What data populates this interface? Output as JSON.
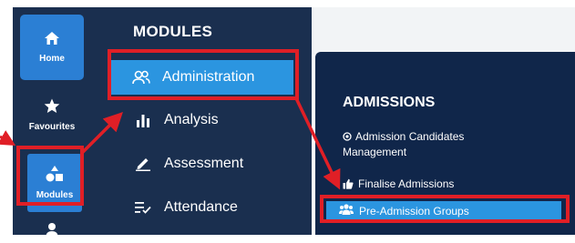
{
  "rail": {
    "home_label": "Home",
    "favourites_label": "Favourites",
    "modules_label": "Modules"
  },
  "modules_panel": {
    "title": "MODULES",
    "items": [
      {
        "label": "Administration",
        "icon": "users-icon"
      },
      {
        "label": "Analysis",
        "icon": "bar-chart-icon"
      },
      {
        "label": "Assessment",
        "icon": "pencil-icon"
      },
      {
        "label": "Attendance",
        "icon": "checklist-icon"
      }
    ]
  },
  "admissions_panel": {
    "title": "ADMISSIONS",
    "links": [
      {
        "label": "Admission Candidates Management",
        "icon": "target-icon"
      },
      {
        "label": "Finalise Admissions",
        "icon": "thumbs-up-icon"
      },
      {
        "label": "Pre-Admission Groups",
        "icon": "group-icon"
      }
    ]
  },
  "colors": {
    "panel_bg": "#1a2f4f",
    "accent": "#2b95e0",
    "highlight": "#e01f26"
  }
}
